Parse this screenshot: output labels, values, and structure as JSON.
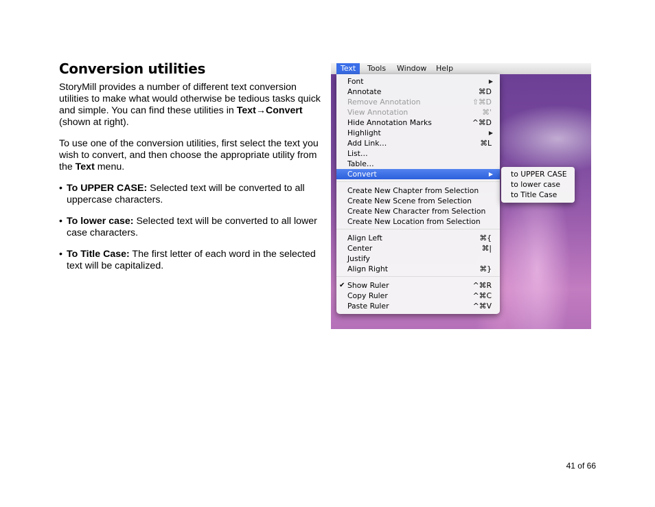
{
  "page": {
    "title": "Conversion utilities",
    "intro": {
      "text1": "StoryMill provides a number of different text conversion utilities to make what would otherwise be tedious tasks quick and simple.  You can find these utilities in ",
      "path_text": "Text",
      "arrow": "→",
      "path_convert": "Convert",
      "text2": " (shown at right)."
    },
    "usage": {
      "text1": "To use one of the conversion utilities, first select the text you wish to convert, and then choose the appropriate utility from the ",
      "menu_name": "Text",
      "text2": " menu."
    },
    "bullets": [
      {
        "term": "To UPPER CASE:",
        "desc": " Selected text will be converted to all uppercase characters."
      },
      {
        "term": "To lower case:",
        "desc": " Selected text will be converted to all lower case characters."
      },
      {
        "term": "To Title Case:",
        "desc": " The first letter of each word in the selected text will be capitalized."
      }
    ],
    "bullet_char": "•",
    "page_number": "41 of 66"
  },
  "screenshot": {
    "menubar": [
      "Text",
      "Tools",
      "Window",
      "Help"
    ],
    "menu_items": [
      {
        "label": "Font",
        "shortcut": "",
        "arrow": "▶"
      },
      {
        "label": "Annotate",
        "shortcut": "⌘D"
      },
      {
        "label": "Remove Annotation",
        "shortcut": "⇧⌘D"
      },
      {
        "label": "View Annotation",
        "shortcut": "⌘'"
      },
      {
        "label": "Hide Annotation Marks",
        "shortcut": "^⌘D"
      },
      {
        "label": "Highlight",
        "shortcut": "",
        "arrow": "▶"
      },
      {
        "label": "Add Link…",
        "shortcut": "⌘L"
      },
      {
        "label": "List…",
        "shortcut": ""
      },
      {
        "label": "Table…",
        "shortcut": ""
      },
      {
        "label": "Convert",
        "shortcut": "",
        "arrow": "▶"
      },
      {
        "label": "Create New Chapter from Selection",
        "shortcut": ""
      },
      {
        "label": "Create New Scene from Selection",
        "shortcut": ""
      },
      {
        "label": "Create New Character from Selection",
        "shortcut": ""
      },
      {
        "label": "Create New Location from Selection",
        "shortcut": ""
      },
      {
        "label": "Align Left",
        "shortcut": "⌘{"
      },
      {
        "label": "Center",
        "shortcut": "⌘|"
      },
      {
        "label": "Justify",
        "shortcut": ""
      },
      {
        "label": "Align Right",
        "shortcut": "⌘}"
      },
      {
        "label": "Show Ruler",
        "shortcut": "^⌘R",
        "check": "✔"
      },
      {
        "label": "Copy Ruler",
        "shortcut": "^⌘C"
      },
      {
        "label": "Paste Ruler",
        "shortcut": "^⌘V"
      }
    ],
    "submenu_items": [
      "to UPPER CASE",
      "to lower case",
      "to Title Case"
    ]
  }
}
